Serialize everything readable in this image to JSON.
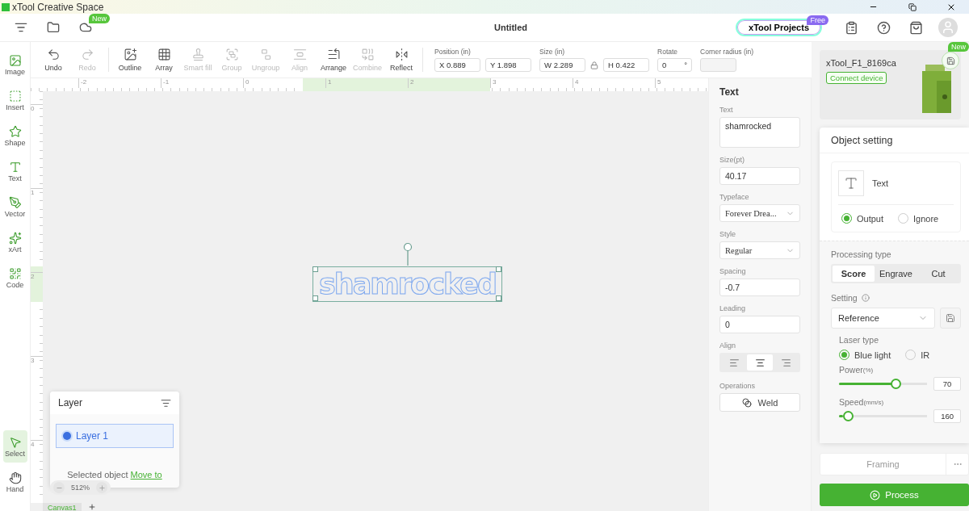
{
  "app_title": "xTool Creative Space",
  "header": {
    "new_badge": "New",
    "document_title": "Untitled",
    "projects_button": "xTool Projects",
    "free_badge": "Free"
  },
  "sidebar": {
    "items": [
      {
        "label": "Image",
        "selected": false
      },
      {
        "label": "Insert",
        "selected": false
      },
      {
        "label": "Shape",
        "selected": false
      },
      {
        "label": "Text",
        "selected": false
      },
      {
        "label": "Vector",
        "selected": false
      },
      {
        "label": "xArt",
        "selected": false
      },
      {
        "label": "Code",
        "selected": false
      },
      {
        "label": "Select",
        "selected": true
      },
      {
        "label": "Hand",
        "selected": false
      }
    ]
  },
  "toolbar": {
    "buttons": [
      {
        "label": "Undo",
        "disabled": false
      },
      {
        "label": "Redo",
        "disabled": true
      },
      {
        "label": "Outline",
        "disabled": false
      },
      {
        "label": "Array",
        "disabled": false
      },
      {
        "label": "Smart fill",
        "disabled": true
      },
      {
        "label": "Group",
        "disabled": true
      },
      {
        "label": "Ungroup",
        "disabled": true
      },
      {
        "label": "Align",
        "disabled": true
      },
      {
        "label": "Arrange",
        "disabled": false
      },
      {
        "label": "Combine",
        "disabled": true
      },
      {
        "label": "Reflect",
        "disabled": false
      }
    ],
    "position": {
      "label": "Position (in)",
      "x": "X 0.889",
      "y": "Y 1.898"
    },
    "size": {
      "label": "Size (in)",
      "w": "W 2.289",
      "h": "H 0.422"
    },
    "rotate": {
      "label": "Rotate",
      "value": "0",
      "unit": "°"
    },
    "corner_radius": {
      "label": "Corner radius (in)"
    }
  },
  "ruler": {
    "horizontal": [
      "-2",
      "-1",
      "0",
      "1",
      "2",
      "3",
      "4",
      "5"
    ],
    "vertical": [
      "0",
      "1",
      "2",
      "3",
      "4"
    ]
  },
  "canvas": {
    "text": "shamrocked",
    "zoom": "512%",
    "tabs": [
      {
        "label": "Canvas1",
        "selected": true
      }
    ]
  },
  "layer_panel": {
    "title": "Layer",
    "layers": [
      {
        "name": "Layer 1",
        "selected": true
      }
    ],
    "footer_text": "Selected object",
    "footer_link": "Move to"
  },
  "text_panel": {
    "title": "Text",
    "fields": [
      {
        "label": "Text",
        "value": "shamrocked",
        "kind": "textarea"
      },
      {
        "label": "Size(pt)",
        "value": "40.17",
        "kind": "input"
      },
      {
        "label": "Typeface",
        "value": "Forever Drea...",
        "kind": "select"
      },
      {
        "label": "Style",
        "value": "Regular",
        "kind": "select"
      },
      {
        "label": "Spacing",
        "value": "-0.7",
        "kind": "input"
      },
      {
        "label": "Leading",
        "value": "0",
        "kind": "input"
      }
    ],
    "align": {
      "label": "Align",
      "options": [
        {
          "selected": false
        },
        {
          "selected": true
        },
        {
          "selected": false
        }
      ]
    },
    "operations": {
      "label": "Operations",
      "button": "Weld"
    }
  },
  "device": {
    "name": "xTool_F1_8169ca",
    "connect": "Connect device",
    "new_badge": "New"
  },
  "object_setting": {
    "title": "Object setting",
    "object_type": "Text",
    "output_options": [
      {
        "label": "Output",
        "selected": true
      },
      {
        "label": "Ignore",
        "selected": false
      }
    ],
    "processing_label": "Processing type",
    "processing_types": [
      {
        "label": "Score",
        "selected": true
      },
      {
        "label": "Engrave",
        "selected": false
      },
      {
        "label": "Cut",
        "selected": false
      }
    ],
    "setting_label": "Setting",
    "setting_value": "Reference",
    "laser_label": "Laser type",
    "laser_types": [
      {
        "label": "Blue light",
        "selected": true
      },
      {
        "label": "IR",
        "selected": false
      }
    ],
    "sliders": [
      {
        "label": "Power",
        "unit": "(%)",
        "level": 0.67,
        "value": "70"
      },
      {
        "label": "Speed",
        "unit": "(mm/s)",
        "level": 0.05,
        "value": "160"
      }
    ]
  },
  "actions": {
    "framing": "Framing",
    "process": "Process"
  }
}
